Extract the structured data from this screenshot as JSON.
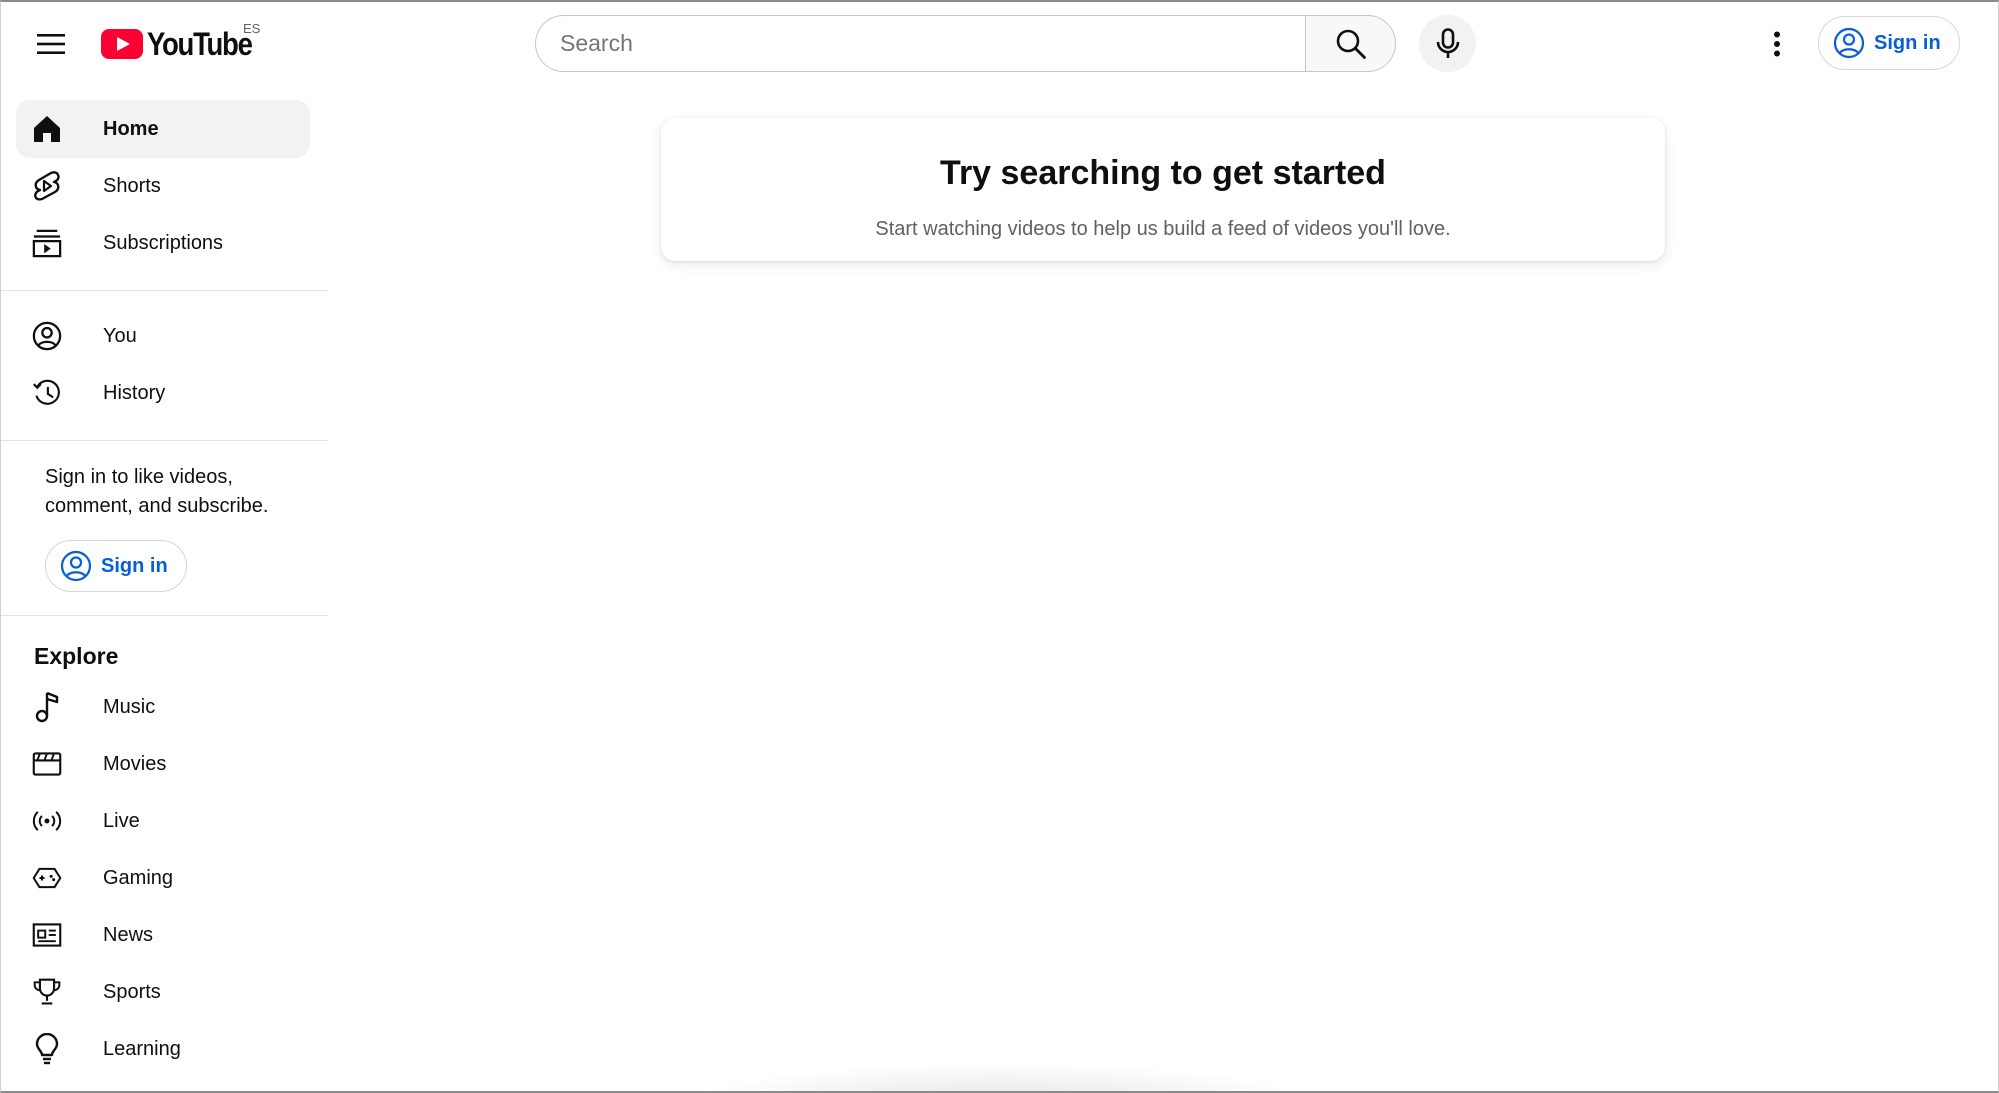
{
  "header": {
    "logo_text": "YouTube",
    "country_code": "ES",
    "search_placeholder": "Search",
    "sign_in_label": "Sign in",
    "icons": [
      "menu-icon",
      "youtube-logo-icon",
      "search-icon",
      "microphone-icon",
      "more-vert-icon",
      "account-circle-icon"
    ],
    "colors": {
      "brand_red": "#ff0033",
      "link_blue": "#065fd4"
    }
  },
  "sidebar": {
    "primary": [
      {
        "label": "Home",
        "icon": "home-icon",
        "active": true
      },
      {
        "label": "Shorts",
        "icon": "shorts-icon"
      },
      {
        "label": "Subscriptions",
        "icon": "subscriptions-icon"
      }
    ],
    "you": [
      {
        "label": "You",
        "icon": "account-circle-icon"
      },
      {
        "label": "History",
        "icon": "history-icon"
      }
    ],
    "signin_prompt": "Sign in to like videos, comment, and subscribe.",
    "signin_label": "Sign in",
    "explore_title": "Explore",
    "explore": [
      {
        "label": "Music",
        "icon": "music-note-icon"
      },
      {
        "label": "Movies",
        "icon": "clapperboard-icon"
      },
      {
        "label": "Live",
        "icon": "live-broadcast-icon"
      },
      {
        "label": "Gaming",
        "icon": "gamepad-icon"
      },
      {
        "label": "News",
        "icon": "newspaper-icon"
      },
      {
        "label": "Sports",
        "icon": "trophy-icon"
      },
      {
        "label": "Learning",
        "icon": "lightbulb-icon"
      }
    ]
  },
  "main": {
    "prompt_title": "Try searching to get started",
    "prompt_subtitle": "Start watching videos to help us build a feed of videos you'll love."
  }
}
